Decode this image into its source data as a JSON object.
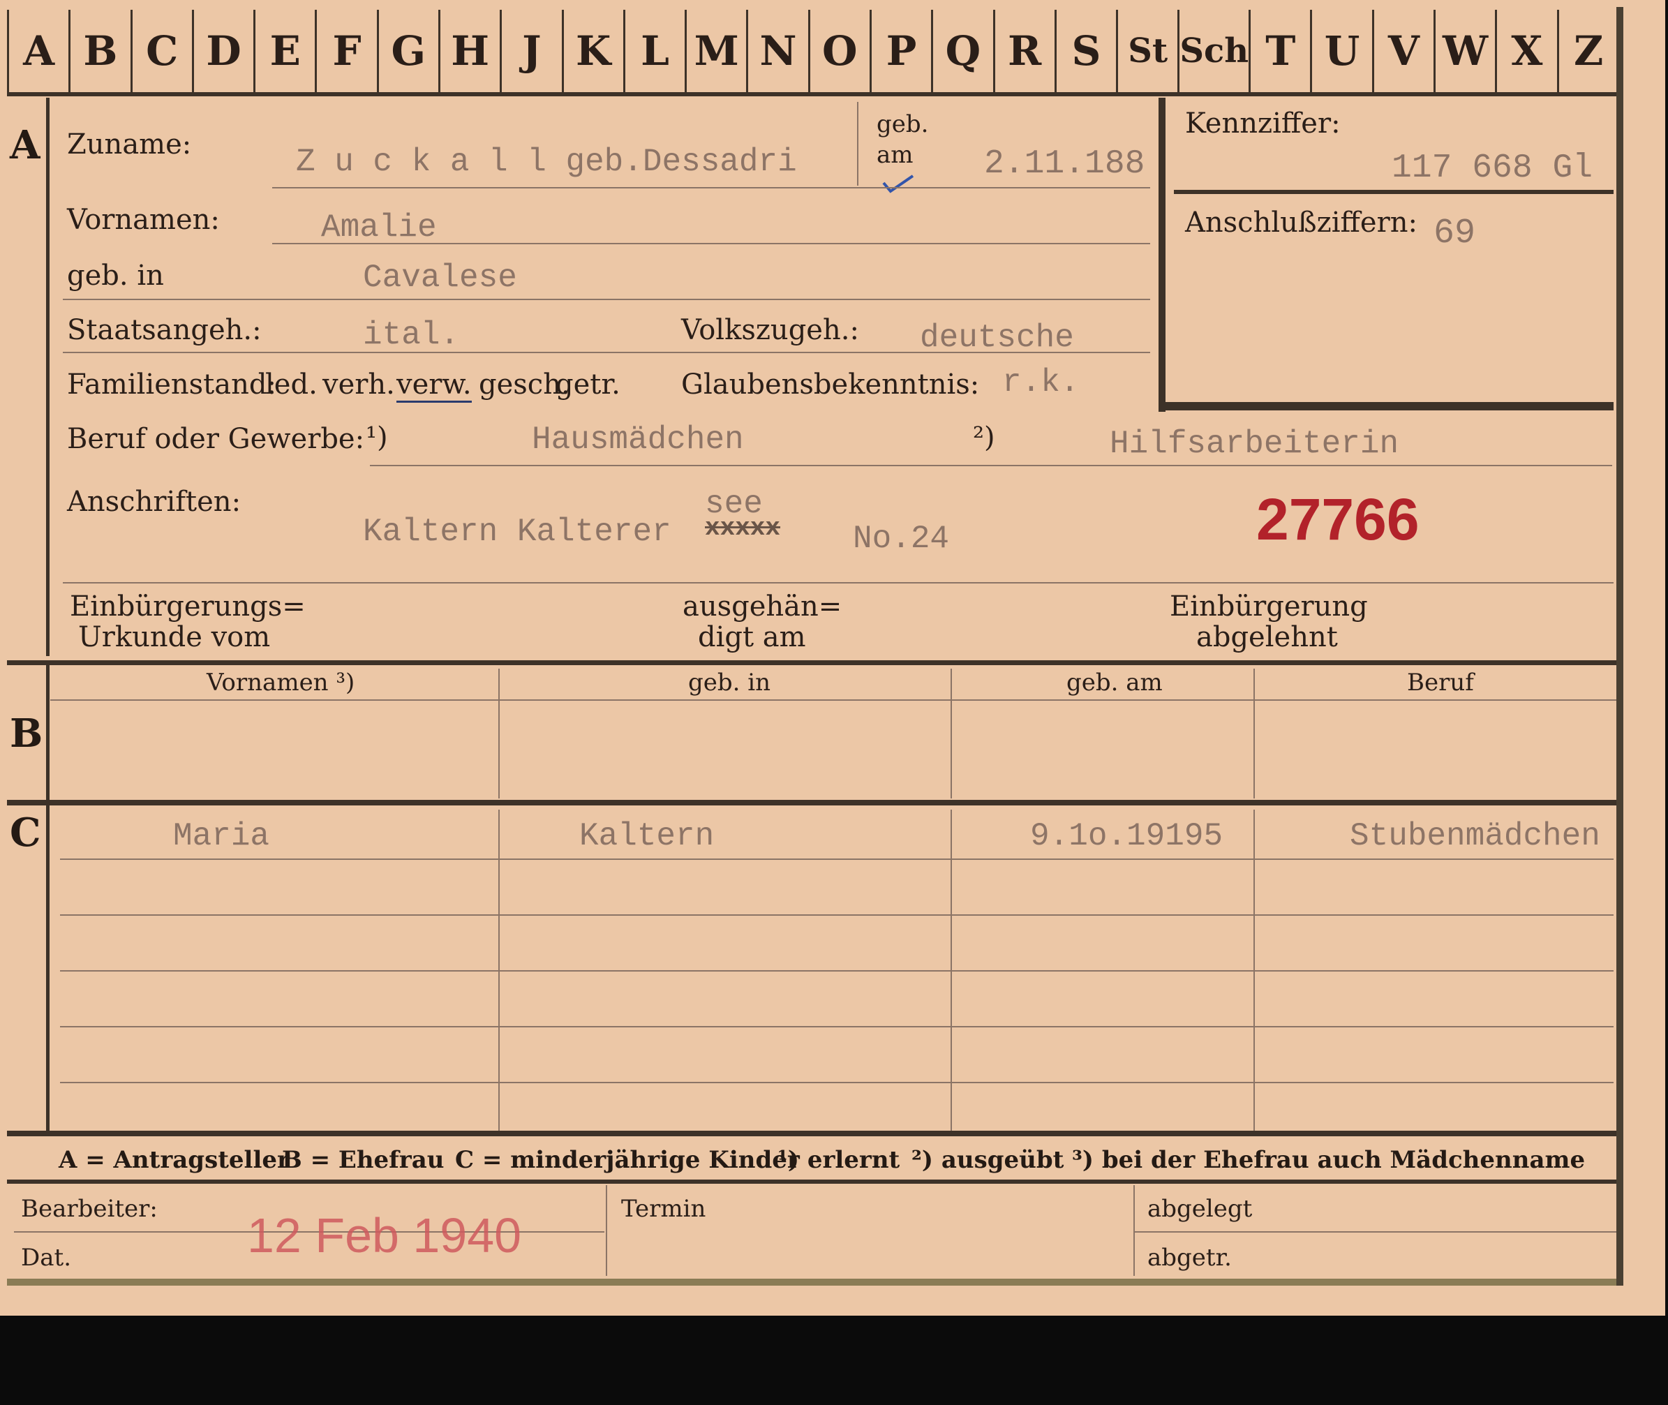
{
  "tabs": [
    "A",
    "B",
    "C",
    "D",
    "E",
    "F",
    "G",
    "H",
    "J",
    "K",
    "L",
    "M",
    "N",
    "O",
    "P",
    "Q",
    "R",
    "S",
    "St",
    "Sch",
    "T",
    "U",
    "V",
    "W",
    "X",
    "Z"
  ],
  "section_labels": {
    "a": "A",
    "b": "B",
    "c": "C"
  },
  "section_a": {
    "zuname_label": "Zuname:",
    "zuname_value": "Z u c k a l l  geb.Dessadri",
    "geb_am_label_1": "geb.",
    "geb_am_label_2": "am",
    "geb_am_value": "2.11.188",
    "vornamen_label": "Vornamen:",
    "vornamen_value": "Amalie",
    "geb_in_label": "geb. in",
    "geb_in_value": "Cavalese",
    "staatsangeh_label": "Staatsangeh.:",
    "staatsangeh_value": "ital.",
    "volkszugeh_label": "Volkszugeh.:",
    "volkszugeh_value": "deutsche",
    "familienstand_label": "Familienstand:",
    "familienstand_options": [
      "led.",
      "verh.",
      "verw.",
      "gesch.",
      "getr."
    ],
    "glauben_label": "Glaubensbekenntnis:",
    "glauben_value": "r.k.",
    "kennziffer_label": "Kennziffer:",
    "kennziffer_value": "117 668 Gl",
    "anschluss_label": "Anschlußziffern:",
    "anschluss_value": "69",
    "beruf_label": "Beruf oder Gewerbe:",
    "beruf_note1": "¹)",
    "beruf_value1": "Hausmädchen",
    "beruf_note2": "²)",
    "beruf_value2": "Hilfsarbeiterin",
    "anschriften_label": "Anschriften:",
    "anschriften_above": "see",
    "anschriften_value": "Kaltern Kalterer",
    "anschriften_struck": "xxxxx",
    "anschriften_no": "No.24",
    "stamp_number": "27766",
    "einb_label_1": "Einbürgerungs=",
    "einb_label_2": "Urkunde vom",
    "ausgeh_label_1": "ausgehän=",
    "ausgeh_label_2": "digt am",
    "abgelehnt_label_1": "Einbürgerung",
    "abgelehnt_label_2": "abgelehnt"
  },
  "section_b": {
    "headers": [
      "Vornamen ³)",
      "geb. in",
      "geb. am",
      "Beruf"
    ]
  },
  "section_c": {
    "rows": [
      {
        "vorname": "Maria",
        "geb_in": "Kaltern",
        "geb_am": "9.1o.19195",
        "beruf": "Stubenmädchen"
      }
    ]
  },
  "legend": {
    "a": "A = Antragsteller",
    "b": "B = Ehefrau",
    "c": "C = minderjährige Kinder",
    "n1": "¹) erlernt",
    "n2": "²) ausgeübt",
    "n3": "³) bei der Ehefrau auch Mädchenname"
  },
  "footer": {
    "bearbeiter_label": "Bearbeiter:",
    "dat_label": "Dat.",
    "date_stamp": "12 Feb 1940",
    "termin_label": "Termin",
    "abgelegt_label": "abgelegt",
    "abgetr_label": "abgetr."
  },
  "colors": {
    "card": "#ecc7a6",
    "ink": "#2a1e18",
    "typed": "#8d7466",
    "stamp": "#b2222a"
  }
}
